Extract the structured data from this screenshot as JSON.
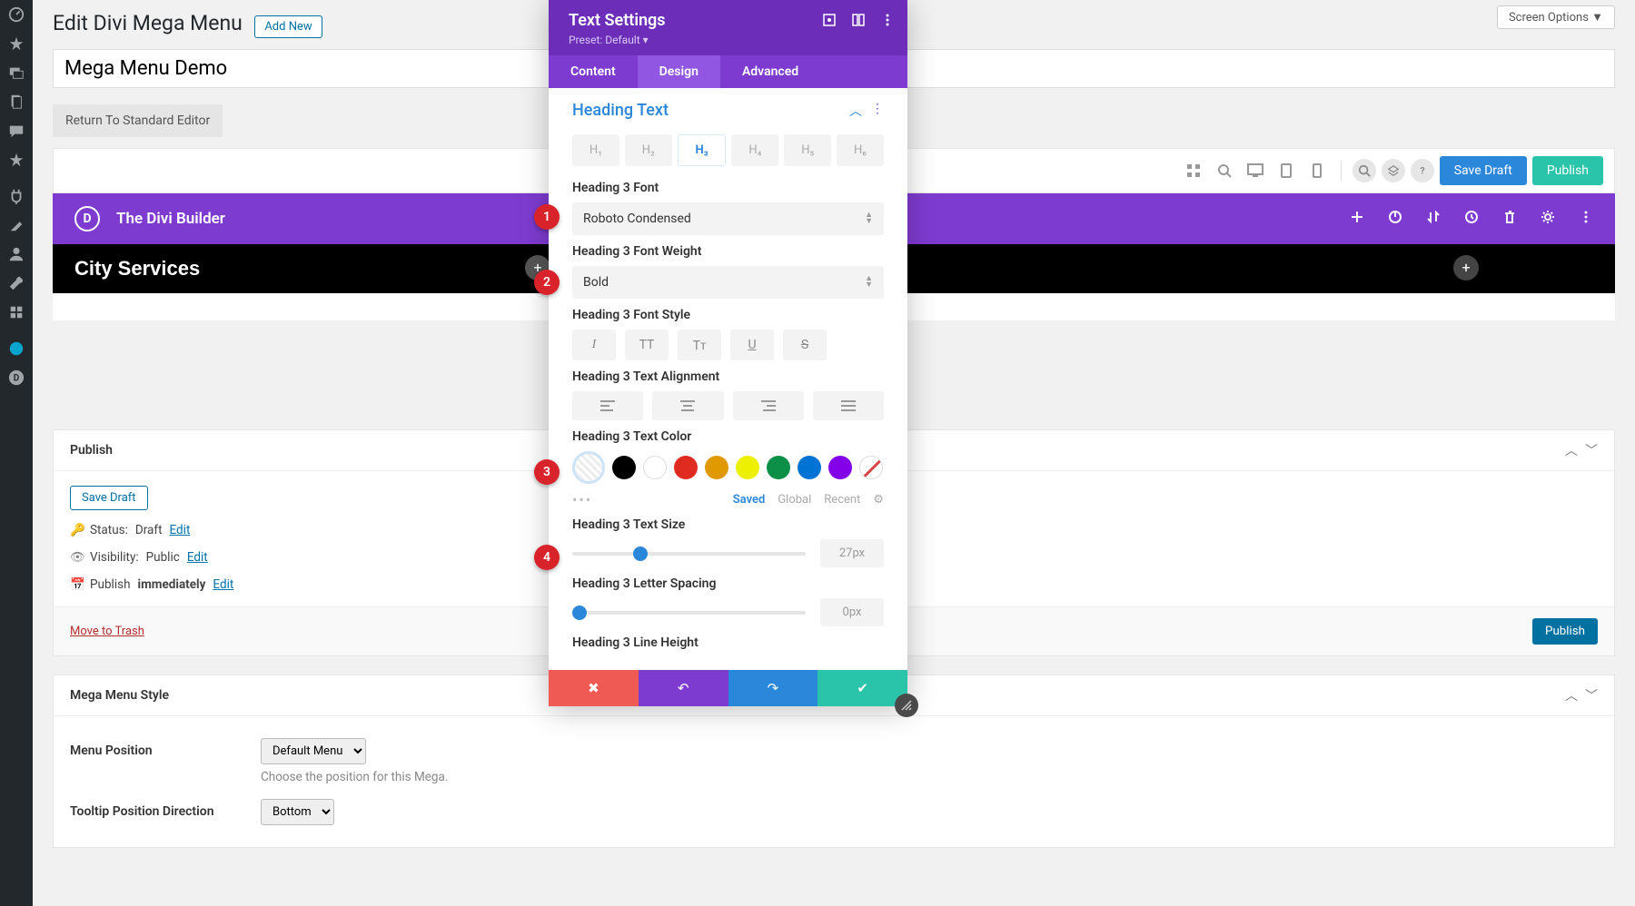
{
  "topbar": {
    "screen_options": "Screen Options ▼"
  },
  "page": {
    "title": "Edit Divi Mega Menu",
    "add_new": "Add New",
    "post_title": "Mega Menu Demo",
    "return_btn": "Return To Standard Editor"
  },
  "toolbar_actions": {
    "save_draft": "Save Draft",
    "publish": "Publish"
  },
  "builder": {
    "title": "The Divi Builder",
    "section_heading": "City Services"
  },
  "publish_box": {
    "heading": "Publish",
    "save_draft_btn": "Save Draft",
    "status_label": "Status:",
    "status_value": "Draft",
    "visibility_label": "Visibility:",
    "visibility_value": "Public",
    "publish_label": "Publish",
    "publish_value": "immediately",
    "edit": "Edit",
    "trash": "Move to Trash",
    "publish_btn": "Publish"
  },
  "mega_menu_style": {
    "heading": "Mega Menu Style",
    "menu_position_label": "Menu Position",
    "menu_position_value": "Default Menu",
    "menu_position_help": "Choose the position for this Mega.",
    "tooltip_dir_label": "Tooltip Position Direction",
    "tooltip_dir_value": "Bottom"
  },
  "modal": {
    "title": "Text Settings",
    "preset": "Preset: Default",
    "tabs": {
      "content": "Content",
      "design": "Design",
      "advanced": "Advanced"
    },
    "toggle_title": "Heading Text",
    "heading_levels": [
      "H₁",
      "H₂",
      "H₃",
      "H₄",
      "H₅",
      "H₆"
    ],
    "font_label": "Heading 3 Font",
    "font_value": "Roboto Condensed",
    "weight_label": "Heading 3 Font Weight",
    "weight_value": "Bold",
    "style_label": "Heading 3 Font Style",
    "style_buttons": {
      "italic": "I",
      "uppercase": "TT",
      "smallcaps": "Tᴛ",
      "underline": "U",
      "strike": "S"
    },
    "align_label": "Heading 3 Text Alignment",
    "color_label": "Heading 3 Text Color",
    "swatches": [
      "#000000",
      "#ffffff",
      "#e02b20",
      "#e09900",
      "#edf000",
      "#0c8f46",
      "#0073d4",
      "#8300e9"
    ],
    "swatch_tabs": {
      "saved": "Saved",
      "global": "Global",
      "recent": "Recent"
    },
    "size_label": "Heading 3 Text Size",
    "size_value": "27px",
    "spacing_label": "Heading 3 Letter Spacing",
    "spacing_value": "0px",
    "lineheight_label": "Heading 3 Line Height"
  },
  "callouts": [
    "1",
    "2",
    "3",
    "4"
  ]
}
